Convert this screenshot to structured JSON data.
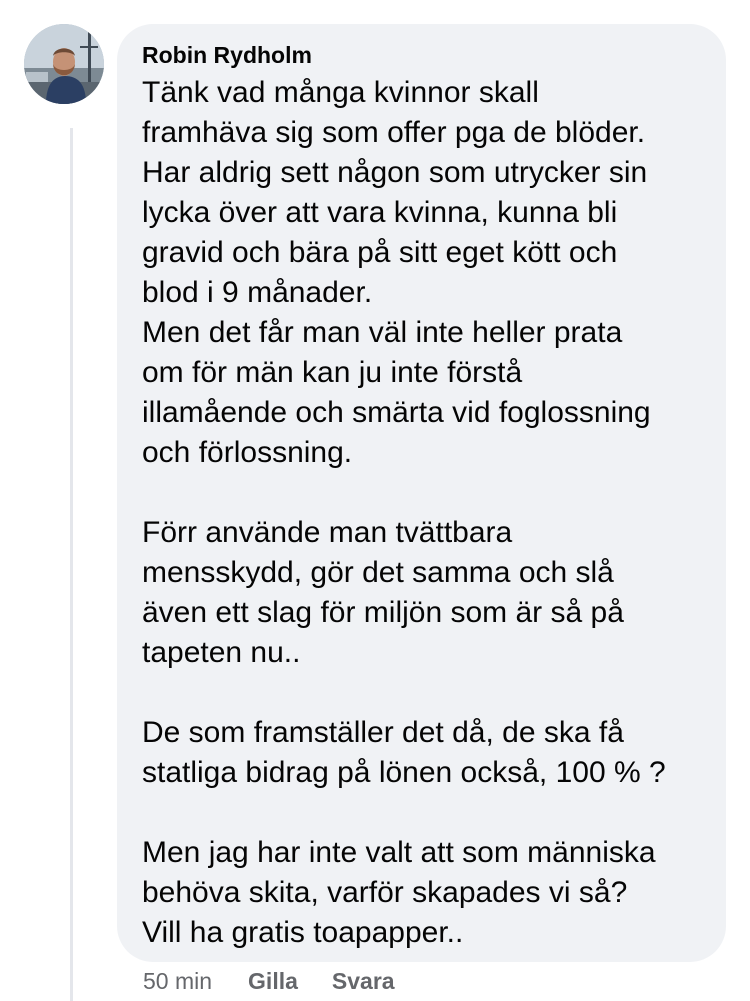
{
  "comment": {
    "author": "Robin Rydholm",
    "paragraphs": [
      {
        "lines": [
          "Tänk vad många kvinnor skall",
          "framhäva sig som offer pga de blöder.",
          "Har aldrig sett någon som utrycker sin",
          "lycka över att vara kvinna, kunna bli",
          "gravid och bära på sitt eget kött och",
          "blod i 9 månader.",
          "Men det får man väl inte heller prata",
          "om för män kan ju inte förstå",
          "illamående och smärta vid foglossning",
          "och förlossning."
        ]
      },
      {
        "lines": [
          "Förr använde man tvättbara",
          "mensskydd, gör det samma och slå",
          "även ett slag för miljön som är så på",
          "tapeten nu.."
        ]
      },
      {
        "lines": [
          "De som framställer det då, de ska få",
          "statliga bidrag på lönen också, 100 % ?"
        ]
      },
      {
        "lines": [
          "Men jag har inte valt att som människa",
          "behöva skita, varför skapades vi så?",
          "Vill ha gratis toapapper.."
        ]
      }
    ],
    "timestamp": "50 min",
    "actions": {
      "like": "Gilla",
      "reply": "Svara"
    }
  },
  "colors": {
    "bubble_background": "#f0f2f5",
    "text": "#050505",
    "meta_text": "#65676b",
    "thread_line": "#e4e6eb"
  },
  "icons": {
    "avatar": "profile-photo-avatar"
  }
}
